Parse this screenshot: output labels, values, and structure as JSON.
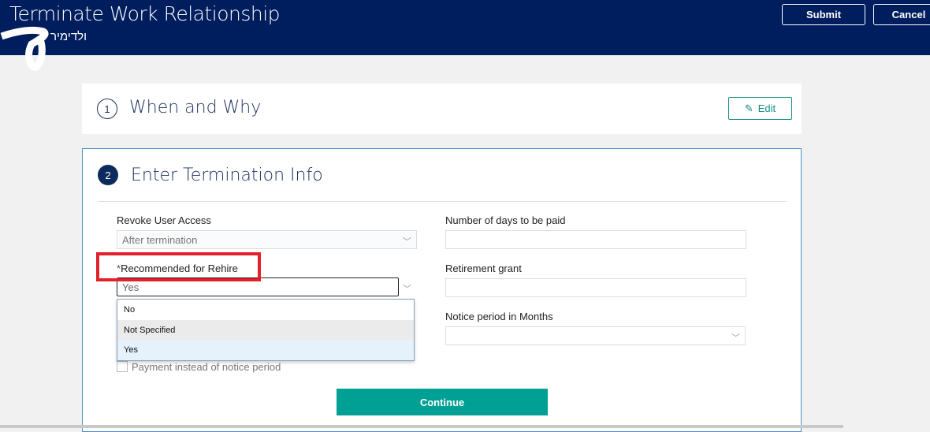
{
  "header": {
    "title": "Terminate Work Relationship",
    "subtitle": "ולדימיר ס",
    "submit": "Submit",
    "cancel": "Cancel"
  },
  "section1": {
    "number": "1",
    "title": "When and Why",
    "edit": "Edit"
  },
  "section2": {
    "number": "2",
    "title": "Enter Termination Info",
    "revoke_label": "Revoke User Access",
    "revoke_value": "After termination",
    "rehire_required": "*",
    "rehire_label": "Recommended for Rehire",
    "rehire_value": "Yes",
    "rehire_options": [
      "No",
      "Not Specified",
      "Yes"
    ],
    "days_label": "Number of days to be paid",
    "days_value": "",
    "grant_label": "Retirement grant",
    "grant_value": "",
    "notice_label": "Notice period in Months",
    "notice_value": "",
    "payment_label": "Payment instead of notice period",
    "continue": "Continue"
  }
}
